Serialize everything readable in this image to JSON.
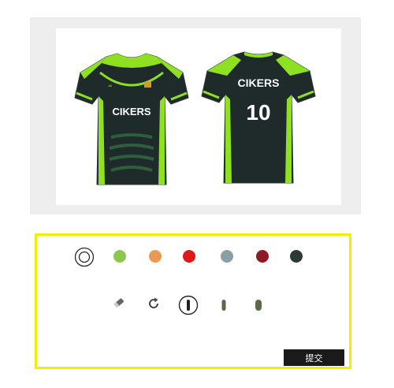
{
  "preview": {
    "front": {
      "brand": "CIKERS"
    },
    "back": {
      "brand": "CIKERS",
      "number": "10"
    },
    "jersey_color": "#1f2b2b",
    "accent_color": "#8ee020"
  },
  "palette": {
    "selected": "none-icon",
    "colors": [
      "#8cc850",
      "#e89a52",
      "#e01818",
      "#8a9fa6",
      "#8c1c24",
      "#2e3838"
    ]
  },
  "tools": [
    "eraser-icon",
    "rotate-icon",
    "stripe-wide-icon",
    "stripe-medium-icon",
    "stripe-thin-icon"
  ],
  "submit_label": "提交"
}
